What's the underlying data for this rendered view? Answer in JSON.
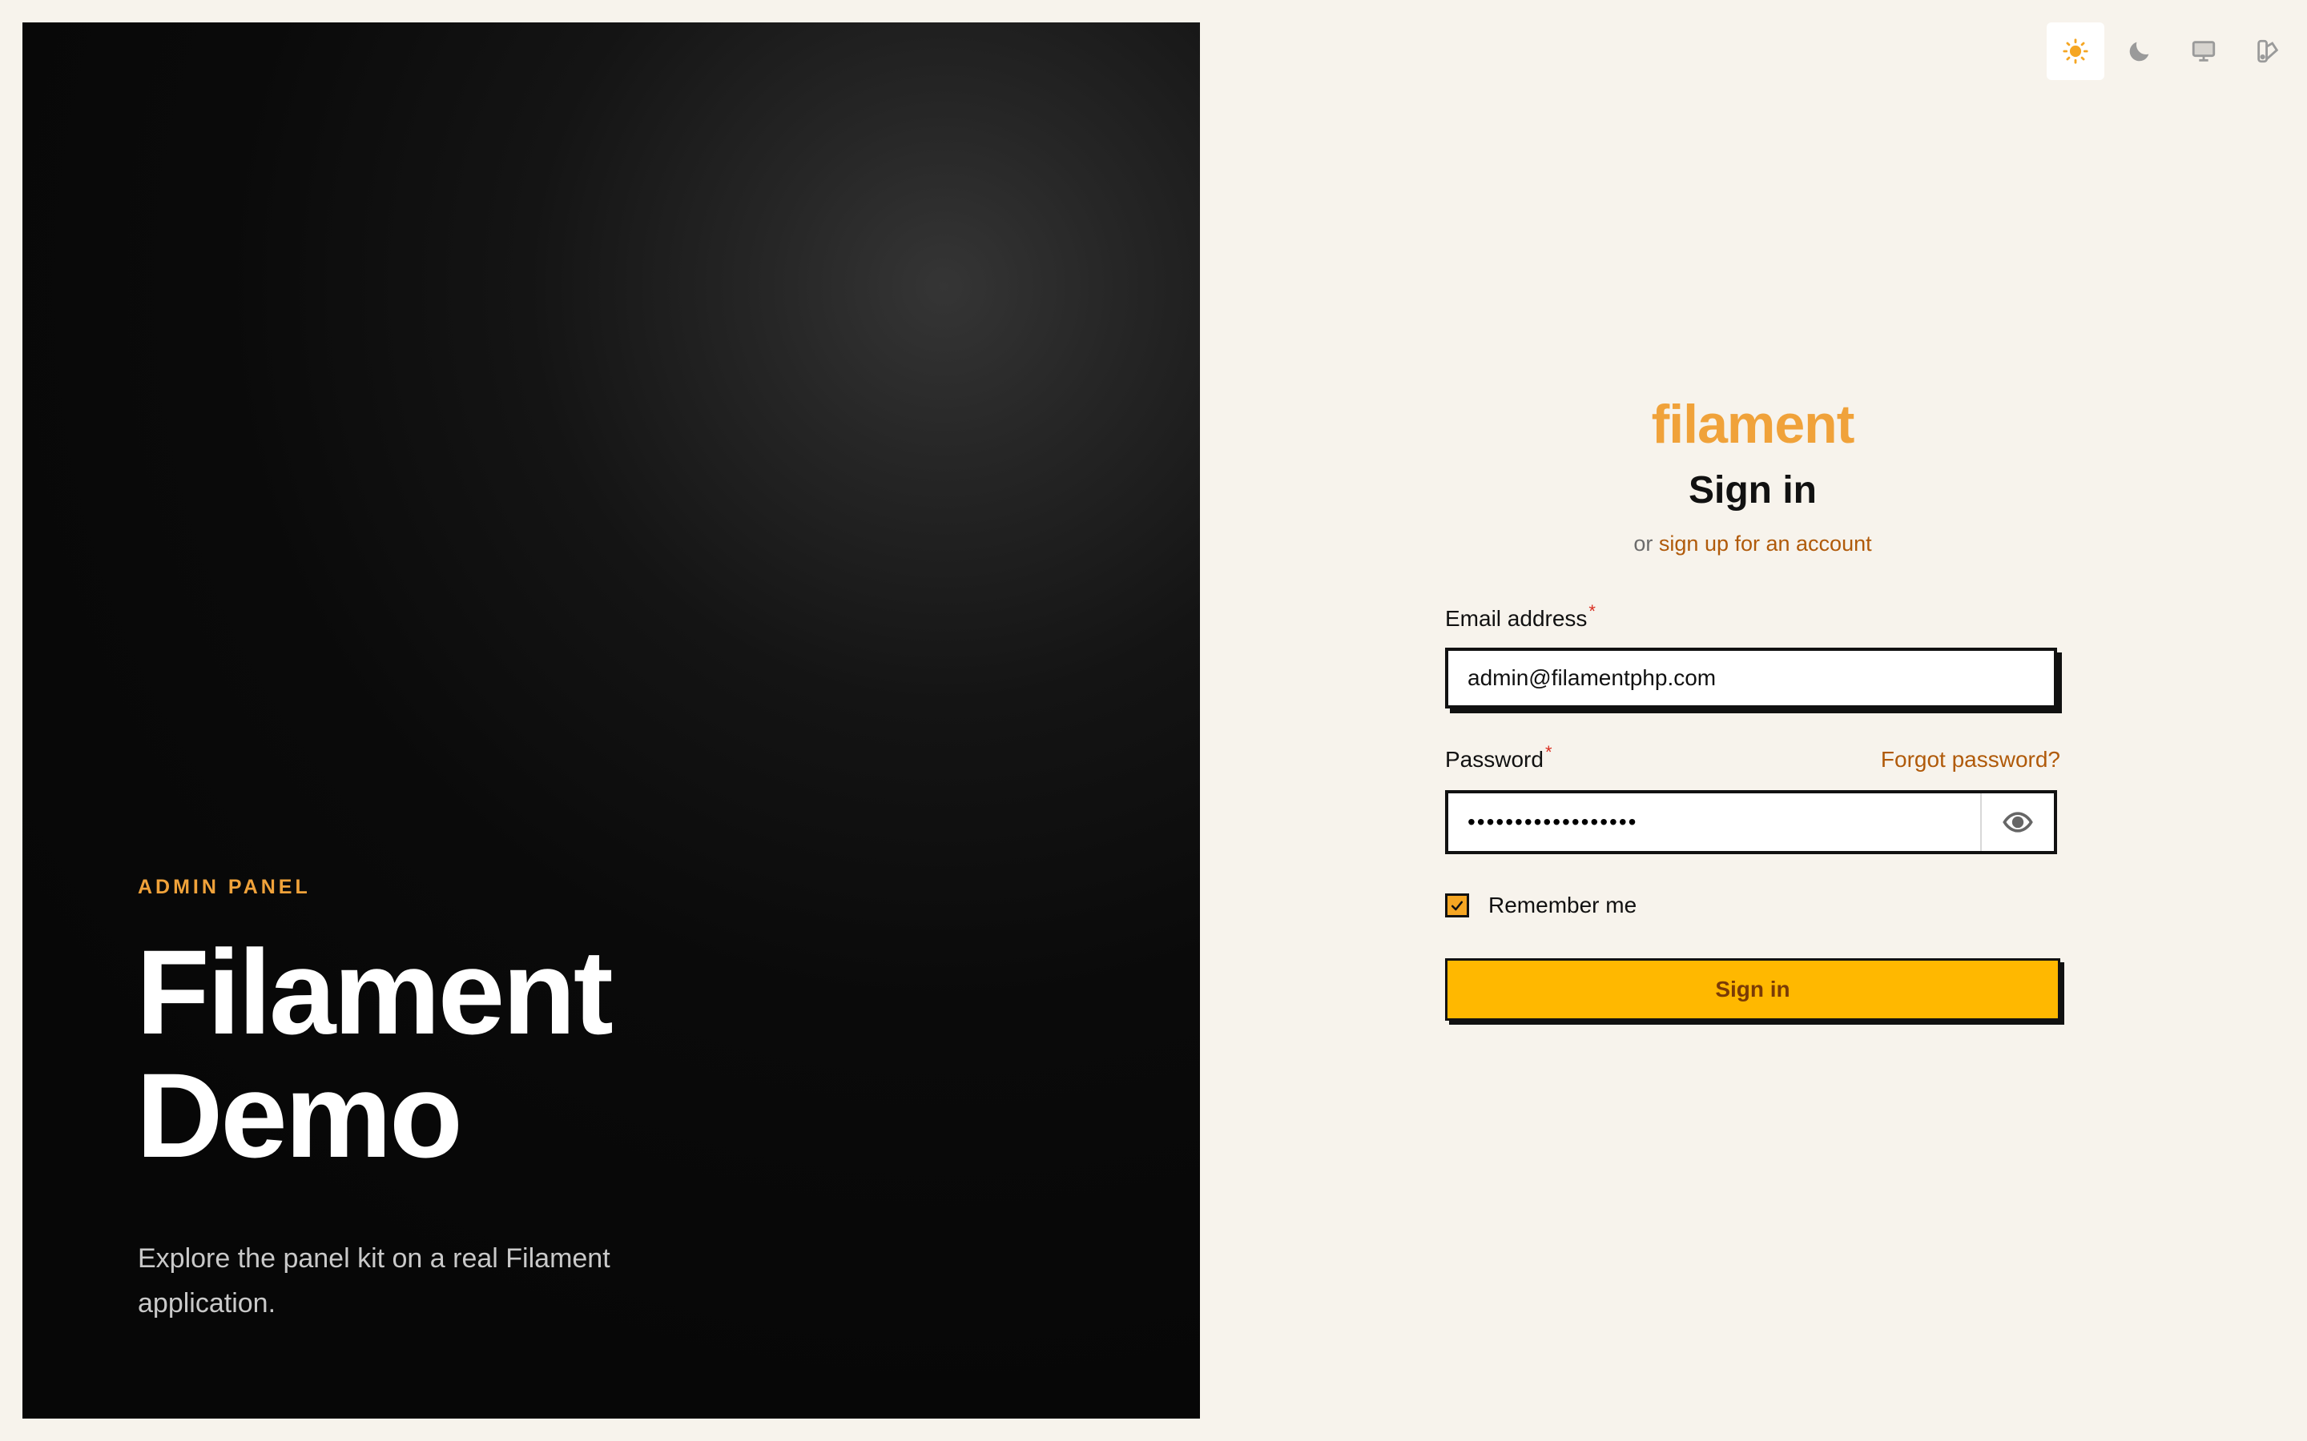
{
  "hero": {
    "eyebrow": "ADMIN PANEL",
    "title_line1": "Filament",
    "title_line2": "Demo",
    "subtitle": "Explore the panel kit on a real Filament application."
  },
  "theme_switcher": {
    "options": [
      {
        "icon": "sun-icon",
        "active": true
      },
      {
        "icon": "moon-icon",
        "active": false
      },
      {
        "icon": "monitor-icon",
        "active": false
      },
      {
        "icon": "swatch-icon",
        "active": false
      }
    ]
  },
  "auth": {
    "logo": "filament",
    "heading": "Sign in",
    "subheading_prefix": "or",
    "signup_link": "sign up for an account",
    "email_label": "Email address",
    "email_value": "admin@filamentphp.com",
    "required_marker": "*",
    "password_label": "Password",
    "forgot_link": "Forgot password?",
    "password_value": "••••••••••••••••••",
    "remember_label": "Remember me",
    "remember_checked": true,
    "submit_label": "Sign in"
  },
  "colors": {
    "accent": "#f0a23a",
    "button": "#ffb800",
    "link": "#b05a0a",
    "background": "#f7f3ec"
  }
}
